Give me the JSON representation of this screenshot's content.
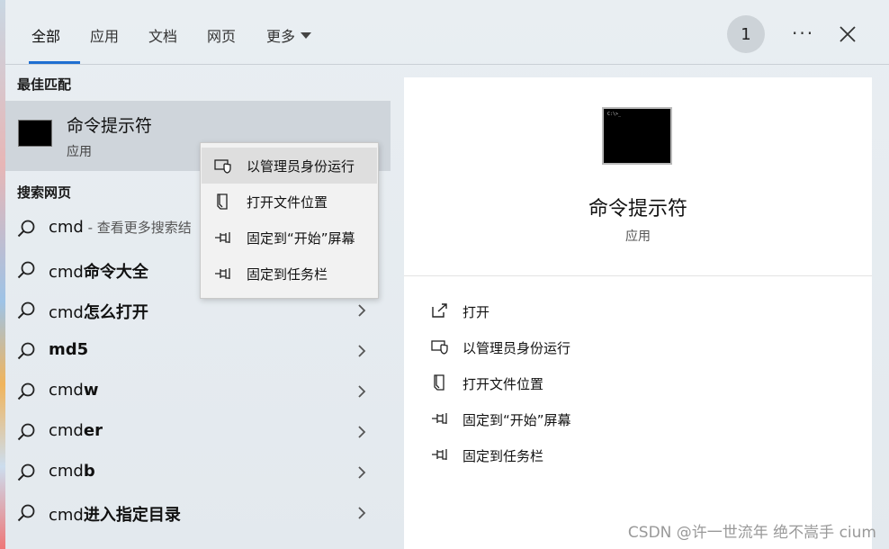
{
  "tabs": [
    {
      "label": "全部",
      "active": true
    },
    {
      "label": "应用"
    },
    {
      "label": "文档"
    },
    {
      "label": "网页"
    },
    {
      "label": "更多"
    }
  ],
  "badge": "1",
  "sections": {
    "best_match": "最佳匹配",
    "search_web": "搜索网页"
  },
  "best_match": {
    "title": "命令提示符",
    "subtitle": "应用"
  },
  "results": [
    {
      "normal": "cmd",
      "bold": "",
      "hint": " - 查看更多搜索结"
    },
    {
      "normal": "cmd",
      "bold": "命令大全"
    },
    {
      "normal": "cmd",
      "bold": "怎么打开"
    },
    {
      "normal": "",
      "bold": "md5"
    },
    {
      "normal": "cmd",
      "bold": "w"
    },
    {
      "normal": "cmd",
      "bold": "er"
    },
    {
      "normal": "cmd",
      "bold": "b"
    },
    {
      "normal": "cmd",
      "bold": "进入指定目录"
    }
  ],
  "context_menu": [
    {
      "label": "以管理员身份运行",
      "icon": "shield-icon",
      "hover": true
    },
    {
      "label": "打开文件位置",
      "icon": "file-location-icon"
    },
    {
      "label": "固定到“开始”屏幕",
      "icon": "pin-icon"
    },
    {
      "label": "固定到任务栏",
      "icon": "pin-icon"
    }
  ],
  "detail": {
    "title": "命令提示符",
    "subtitle": "应用",
    "thumb_text": "C:\\>_",
    "actions": [
      {
        "label": "打开",
        "icon": "open-icon"
      },
      {
        "label": "以管理员身份运行",
        "icon": "shield-icon"
      },
      {
        "label": "打开文件位置",
        "icon": "file-location-icon"
      },
      {
        "label": "固定到“开始”屏幕",
        "icon": "pin-icon"
      },
      {
        "label": "固定到任务栏",
        "icon": "pin-icon"
      }
    ]
  },
  "watermark": "CSDN @许一世流年 绝不嵩手 cium"
}
